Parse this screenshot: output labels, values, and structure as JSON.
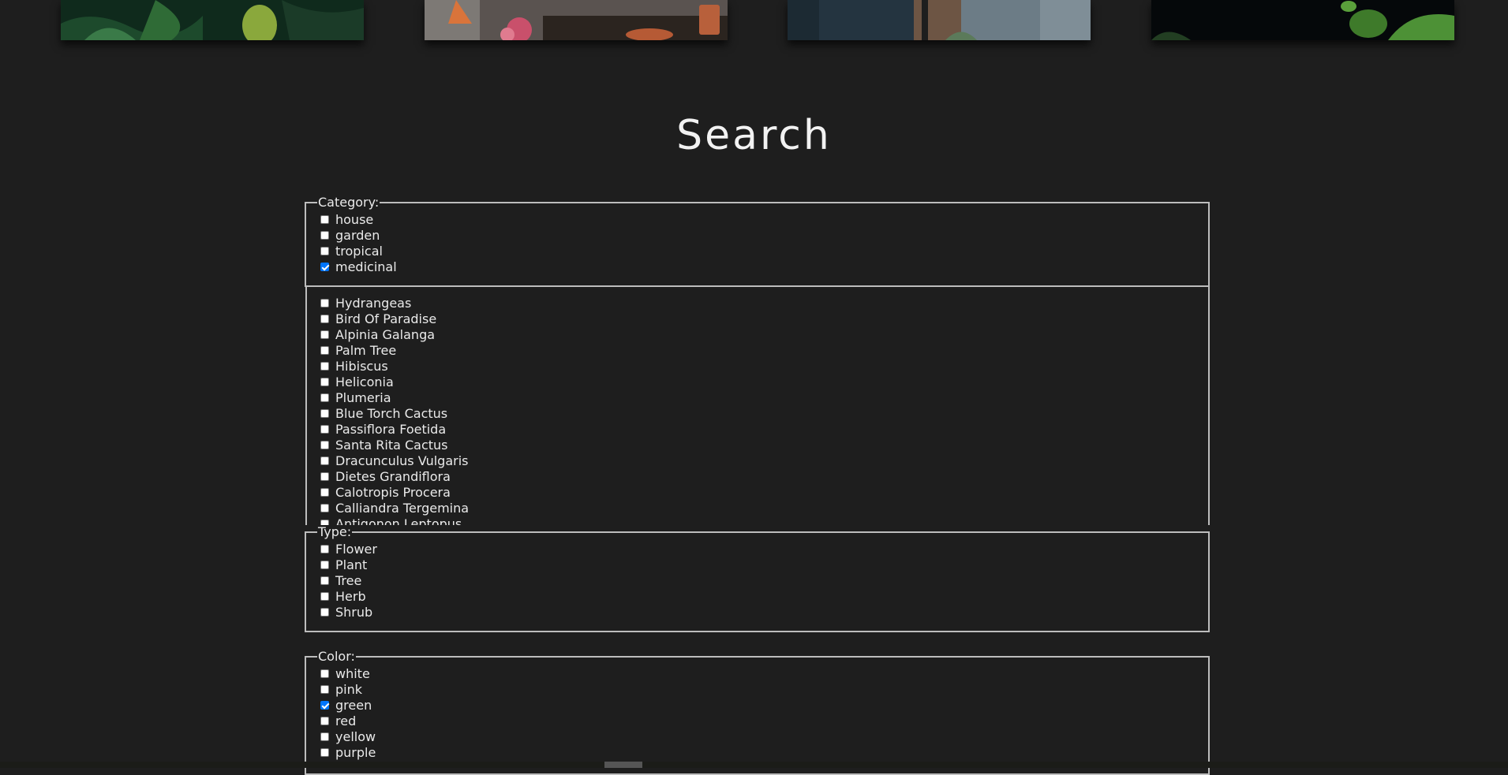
{
  "page": {
    "title": "Search"
  },
  "gallery": {
    "images": [
      "plant-photo-1",
      "plant-photo-2",
      "plant-photo-3",
      "plant-photo-4"
    ]
  },
  "category": {
    "legend": "Category:",
    "options": [
      {
        "label": "house",
        "checked": false
      },
      {
        "label": "garden",
        "checked": false
      },
      {
        "label": "tropical",
        "checked": false
      },
      {
        "label": "medicinal",
        "checked": true
      }
    ]
  },
  "plants": {
    "options": [
      {
        "label": "Hydrangeas",
        "checked": false
      },
      {
        "label": "Bird Of Paradise",
        "checked": false
      },
      {
        "label": "Alpinia Galanga",
        "checked": false
      },
      {
        "label": "Palm Tree",
        "checked": false
      },
      {
        "label": "Hibiscus",
        "checked": false
      },
      {
        "label": "Heliconia",
        "checked": false
      },
      {
        "label": "Plumeria",
        "checked": false
      },
      {
        "label": "Blue Torch Cactus",
        "checked": false
      },
      {
        "label": "Passiflora Foetida",
        "checked": false
      },
      {
        "label": "Santa Rita Cactus",
        "checked": false
      },
      {
        "label": "Dracunculus Vulgaris",
        "checked": false
      },
      {
        "label": "Dietes Grandiflora",
        "checked": false
      },
      {
        "label": "Calotropis Procera",
        "checked": false
      },
      {
        "label": "Calliandra Tergemina",
        "checked": false
      },
      {
        "label": "Antigonon Leptopus",
        "checked": false
      }
    ]
  },
  "type": {
    "legend": "Type:",
    "options": [
      {
        "label": "Flower",
        "checked": false
      },
      {
        "label": "Plant",
        "checked": false
      },
      {
        "label": "Tree",
        "checked": false
      },
      {
        "label": "Herb",
        "checked": false
      },
      {
        "label": "Shrub",
        "checked": false
      }
    ]
  },
  "color": {
    "legend": "Color:",
    "options": [
      {
        "label": "white",
        "checked": false
      },
      {
        "label": "pink",
        "checked": false
      },
      {
        "label": "green",
        "checked": true
      },
      {
        "label": "red",
        "checked": false
      },
      {
        "label": "yellow",
        "checked": false
      },
      {
        "label": "purple",
        "checked": false
      }
    ]
  },
  "colors": {
    "background": "#1e1e1e",
    "text": "#eaeaea",
    "border": "#bdbdbd",
    "checkbox_checked": "#0075ff"
  }
}
